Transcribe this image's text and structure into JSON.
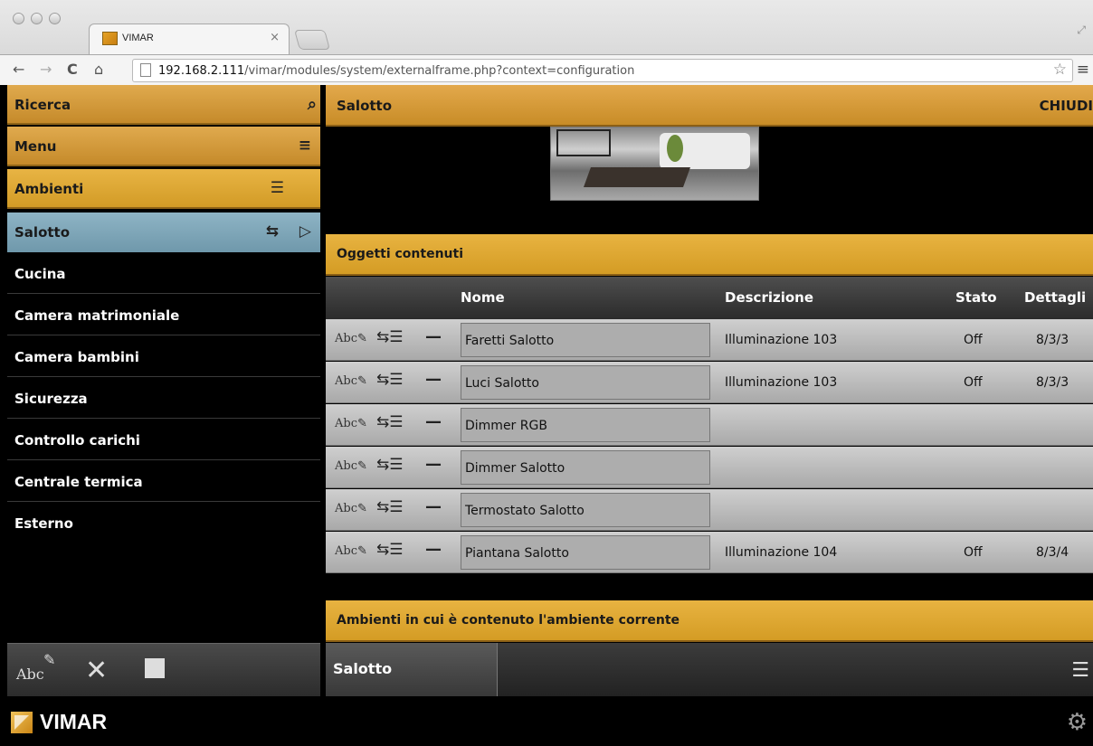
{
  "browser": {
    "tab_title": "VIMAR",
    "tab_close": "×",
    "url_host": "192.168.2.111",
    "url_path": "/vimar/modules/system/externalframe.php?context=configuration"
  },
  "sidebar": {
    "search_label": "Ricerca",
    "menu_label": "Menu",
    "rooms_label": "Ambienti",
    "selected": "Salotto",
    "items": [
      "Cucina",
      "Camera matrimoniale",
      "Camera bambini",
      "Sicurezza",
      "Controllo carichi",
      "Centrale termica",
      "Esterno"
    ],
    "footer_abc": "Abc"
  },
  "main": {
    "title": "Salotto",
    "close_label": "CHIUDI",
    "objects_section": "Oggetti contenuti",
    "columns": {
      "name": "Nome",
      "description": "Descrizione",
      "state": "Stato",
      "details": "Dettagli"
    },
    "rows": [
      {
        "name": "Faretti Salotto",
        "description": "Illuminazione 103",
        "state": "Off",
        "details": "8/3/3"
      },
      {
        "name": "Luci Salotto",
        "description": "Illuminazione 103",
        "state": "Off",
        "details": "8/3/3"
      },
      {
        "name": "Dimmer RGB",
        "description": "",
        "state": "",
        "details": ""
      },
      {
        "name": "Dimmer Salotto",
        "description": "",
        "state": "",
        "details": ""
      },
      {
        "name": "Termostato Salotto",
        "description": "",
        "state": "",
        "details": ""
      },
      {
        "name": "Piantana Salotto",
        "description": "Illuminazione 104",
        "state": "Off",
        "details": "8/3/4"
      }
    ],
    "containers_section": "Ambienti in cui è contenuto l'ambiente corrente",
    "bottom_tab": "Salotto"
  },
  "footer": {
    "brand": "VIMAR"
  },
  "icons": {
    "search": "search-icon",
    "menu": "hamburger-icon",
    "rooms": "room-list-icon",
    "edit": "edit-abc-icon",
    "delete": "close-icon",
    "copy": "copy-icon",
    "settings": "gear-icon",
    "play": "play-icon"
  },
  "colors": {
    "accent": "#d49c24",
    "selected": "#7fa6b8"
  }
}
